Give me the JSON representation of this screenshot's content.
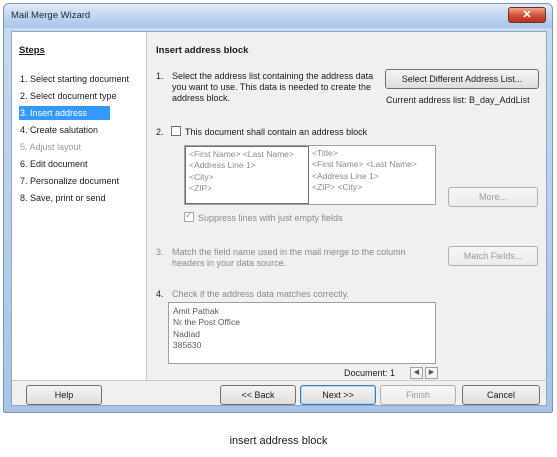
{
  "window": {
    "title": "Mail Merge Wizard",
    "close_glyph": "✕"
  },
  "steps": {
    "title": "Steps",
    "items": [
      {
        "label": "1. Select starting document"
      },
      {
        "label": "2. Select document type"
      },
      {
        "label": "3. Insert address block"
      },
      {
        "label": "4. Create salutation"
      },
      {
        "label": "5. Adjust layout"
      },
      {
        "label": "6. Edit document"
      },
      {
        "label": "7. Personalize document"
      },
      {
        "label": "8. Save, print or send"
      }
    ]
  },
  "main": {
    "title": "Insert address block",
    "section1": {
      "number": "1.",
      "text": "Select the address list containing the address data you want to use. This data is needed to create the address block.",
      "button": "Select Different Address List...",
      "current_list": "Current address list: B_day_AddList"
    },
    "section2": {
      "number": "2.",
      "checkbox_label": "This document shall contain an address block",
      "preview_left": [
        "<First Name> <Last Name>",
        "<Address Line 1>",
        "<City>",
        "<ZIP>"
      ],
      "preview_right": [
        "<Title>",
        "<First Name> <Last Name>",
        "<Address Line 1>",
        "<ZIP> <City>"
      ],
      "more_button": "More...",
      "suppress_label": "Suppress lines with just empty fields"
    },
    "section3": {
      "number": "3.",
      "text": "Match the field name used in the mail merge to the column headers in your data source.",
      "button": "Match Fields..."
    },
    "section4": {
      "number": "4.",
      "text": "Check if the address data matches correctly.",
      "address_lines": [
        "Amit Pathak",
        "Nr the Post Office",
        "Nadiad",
        "385630"
      ],
      "document_label": "Document: 1",
      "prev_glyph": "◀",
      "next_glyph": "▶"
    }
  },
  "footer": {
    "help": "Help",
    "back": "<< Back",
    "next": "Next >>",
    "finish": "Finish",
    "cancel": "Cancel"
  },
  "caption": "insert address block"
}
